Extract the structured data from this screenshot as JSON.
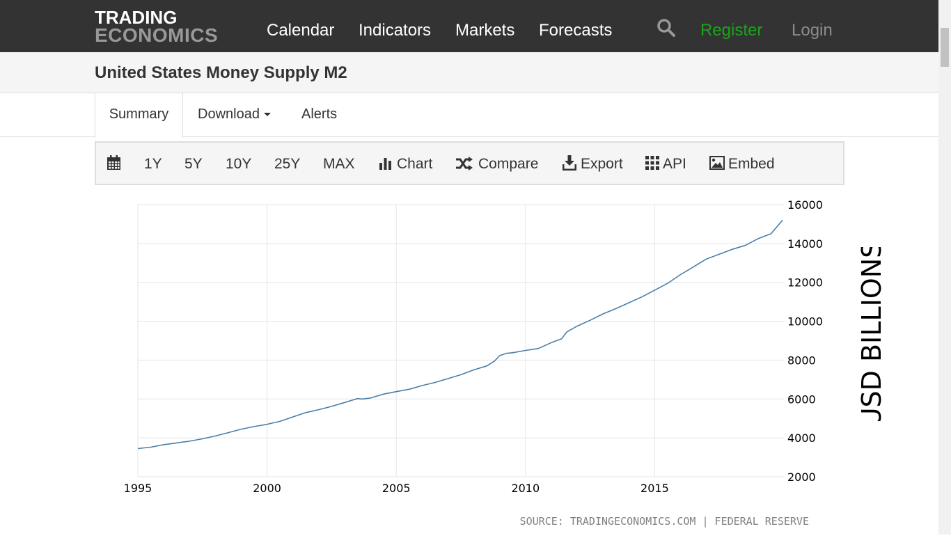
{
  "brand": {
    "line1": "TRADING",
    "line2": "ECONOMICS"
  },
  "nav": {
    "calendar": "Calendar",
    "indicators": "Indicators",
    "markets": "Markets",
    "forecasts": "Forecasts",
    "register": "Register",
    "login": "Login",
    "search_icon": "search-icon"
  },
  "page": {
    "title": "United States Money Supply M2"
  },
  "tabs": {
    "summary": "Summary",
    "download": "Download",
    "alerts": "Alerts"
  },
  "toolbar": {
    "range_1y": "1Y",
    "range_5y": "5Y",
    "range_10y": "10Y",
    "range_25y": "25Y",
    "range_max": "MAX",
    "chart": "Chart",
    "compare": "Compare",
    "export": "Export",
    "api": "API",
    "embed": "Embed"
  },
  "colors": {
    "navbar_bg": "#333333",
    "register": "#1aa51a",
    "line": "#4a7ea8",
    "grid": "#e6e6e6"
  },
  "chart_data": {
    "type": "line",
    "title": "",
    "xlabel": "",
    "ylabel": "USD BILLIONS",
    "source": "SOURCE: TRADINGECONOMICS.COM | FEDERAL RESERVE",
    "xlim": [
      1995,
      2020
    ],
    "ylim": [
      2000,
      16000
    ],
    "x_ticks": [
      "1995",
      "2000",
      "2005",
      "2010",
      "2015"
    ],
    "y_ticks": [
      "2000",
      "4000",
      "6000",
      "8000",
      "10000",
      "12000",
      "14000",
      "16000"
    ],
    "y_axis_side": "right",
    "grid": true,
    "series": [
      {
        "x": [
          1995.0,
          1995.5,
          1996.0,
          1996.5,
          1997.0,
          1997.5,
          1998.0,
          1998.5,
          1999.0,
          1999.5,
          2000.0,
          2000.5,
          2001.0,
          2001.5,
          2002.0,
          2002.5,
          2003.0,
          2003.5,
          2003.7,
          2004.0,
          2004.5,
          2005.0,
          2005.5,
          2006.0,
          2006.5,
          2007.0,
          2007.5,
          2008.0,
          2008.5,
          2008.8,
          2009.0,
          2009.25,
          2009.5,
          2010.0,
          2010.5,
          2011.0,
          2011.4,
          2011.6,
          2012.0,
          2012.5,
          2013.0,
          2013.5,
          2014.0,
          2014.5,
          2015.0,
          2015.5,
          2016.0,
          2016.5,
          2017.0,
          2017.5,
          2018.0,
          2018.5,
          2019.0,
          2019.5,
          2019.95
        ],
        "values": [
          3450,
          3520,
          3650,
          3740,
          3830,
          3950,
          4100,
          4270,
          4450,
          4580,
          4700,
          4850,
          5080,
          5300,
          5450,
          5620,
          5820,
          6020,
          6000,
          6050,
          6250,
          6380,
          6500,
          6690,
          6850,
          7050,
          7250,
          7500,
          7700,
          7950,
          8230,
          8350,
          8380,
          8500,
          8600,
          8900,
          9100,
          9450,
          9750,
          10050,
          10380,
          10650,
          10950,
          11250,
          11600,
          11950,
          12400,
          12800,
          13200,
          13450,
          13700,
          13900,
          14250,
          14500,
          15200
        ]
      }
    ]
  }
}
